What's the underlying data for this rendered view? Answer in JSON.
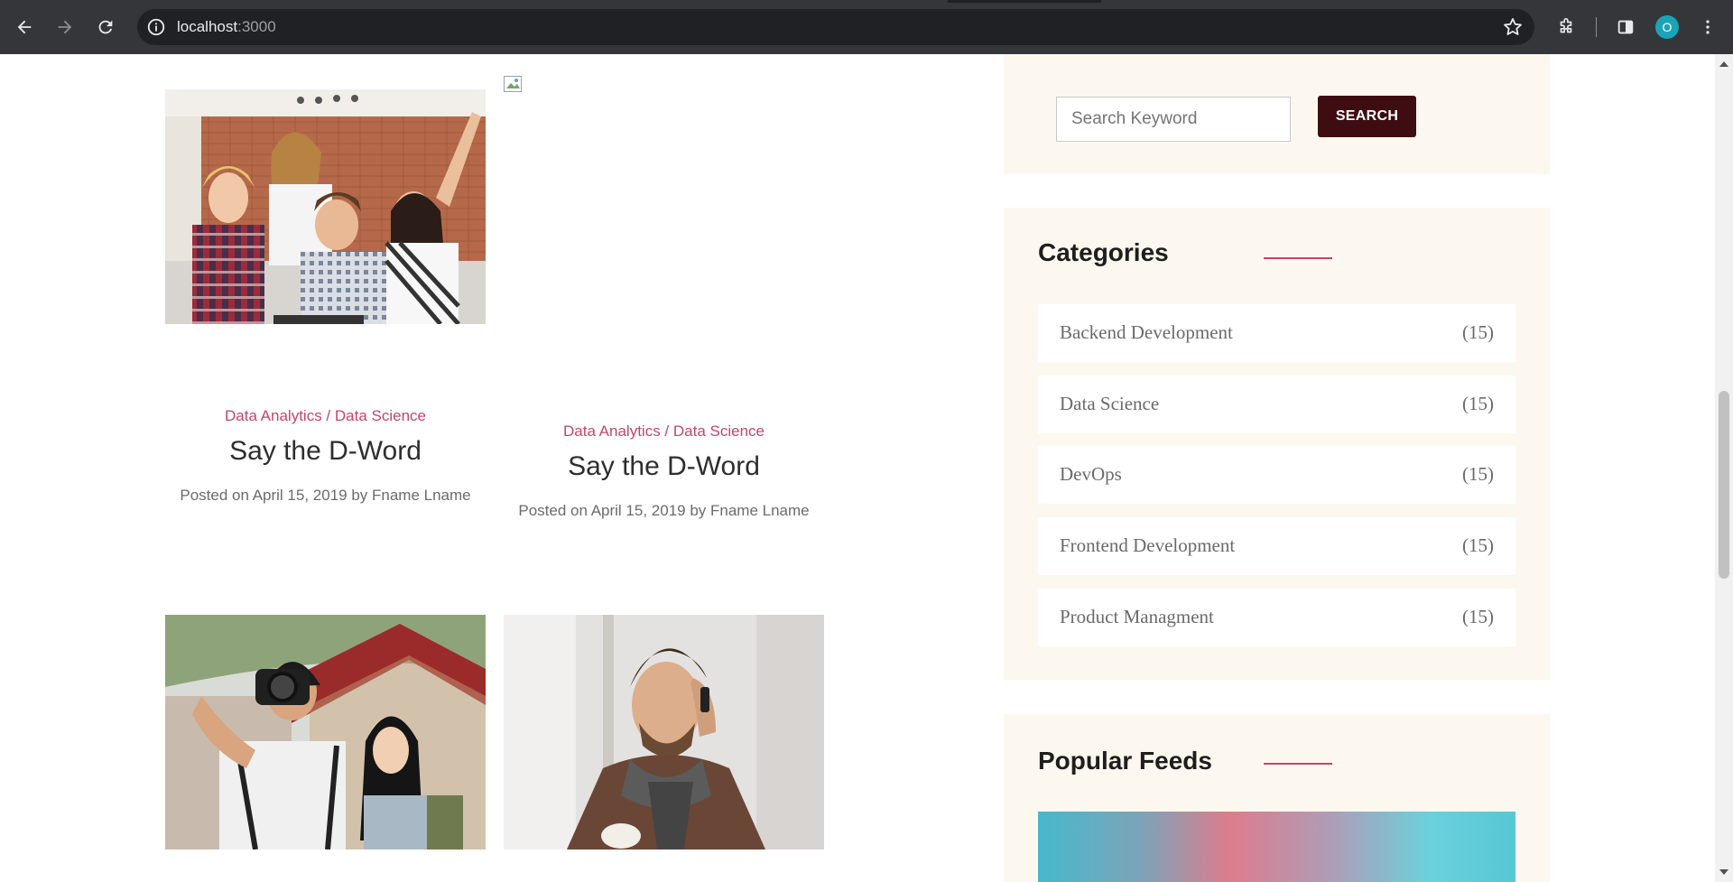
{
  "browser": {
    "url_host": "localhost",
    "url_port": ":3000",
    "profile_initial": "O"
  },
  "posts": [
    {
      "category": "Data Analytics / Data Science",
      "title": "Say the D-Word",
      "posted_prefix": "Posted on ",
      "date": "April 15, 2019",
      "by": " by ",
      "author": "Fname Lname",
      "image": "celebrating-team-photo"
    },
    {
      "category": "Data Analytics / Data Science",
      "title": "Say the D-Word",
      "posted_prefix": "Posted on ",
      "date": "April 15, 2019",
      "by": " by ",
      "author": "Fname Lname",
      "image": "broken-image"
    },
    {
      "image": "photographer-couple-photo"
    },
    {
      "image": "man-on-phone-photo"
    }
  ],
  "sidebar": {
    "search": {
      "placeholder": "Search Keyword",
      "button_label": "SEARCH"
    },
    "categories": {
      "title": "Categories",
      "items": [
        {
          "name": "Backend Development",
          "count": "(15)"
        },
        {
          "name": "Data Science",
          "count": "(15)"
        },
        {
          "name": "DevOps",
          "count": "(15)"
        },
        {
          "name": "Frontend Development",
          "count": "(15)"
        },
        {
          "name": "Product Managment",
          "count": "(15)"
        }
      ]
    },
    "popular_feeds": {
      "title": "Popular Feeds"
    }
  },
  "colors": {
    "accent": "#c2466b",
    "button": "#3d0d12",
    "widget_bg": "#fdf8ef",
    "chrome_bg": "#35363a"
  }
}
